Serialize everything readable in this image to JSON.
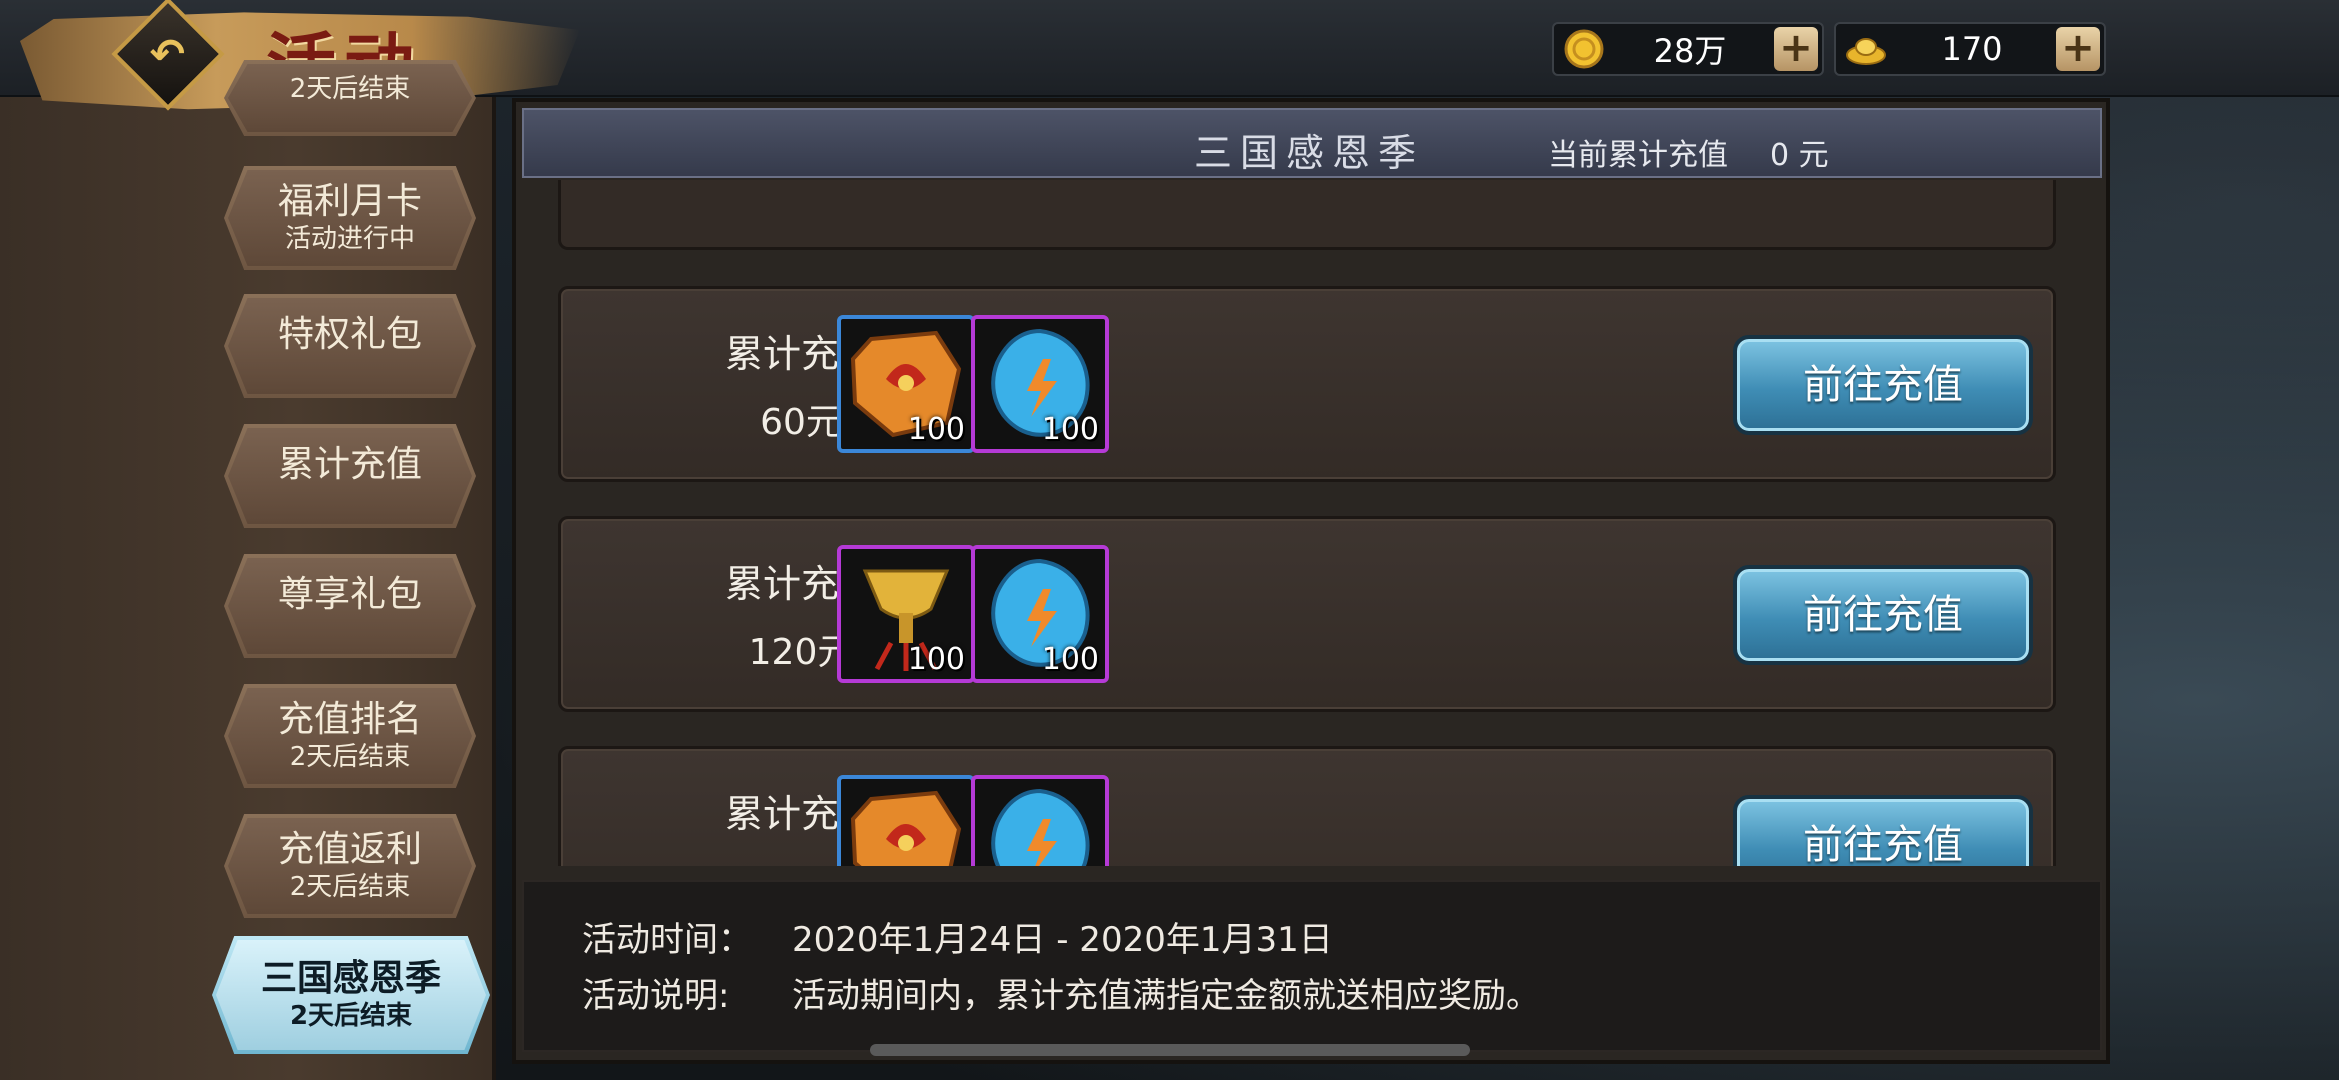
{
  "header": {
    "title": "活动",
    "back_icon": "back-arrow-icon",
    "currencies": [
      {
        "icon": "gold-coin-icon",
        "value": "28万"
      },
      {
        "icon": "gold-ingot-icon",
        "value": "170"
      }
    ]
  },
  "sidebar": {
    "partial_top": {
      "line2": "2天后结束"
    },
    "items": [
      {
        "line1": "福利月卡",
        "line2": "活动进行中"
      },
      {
        "line1": "特权礼包",
        "line2": ""
      },
      {
        "line1": "累计充值",
        "line2": ""
      },
      {
        "line1": "尊享礼包",
        "line2": ""
      },
      {
        "line1": "充值排名",
        "line2": "2天后结束"
      },
      {
        "line1": "充值返利",
        "line2": "2天后结束"
      },
      {
        "line1": "三国感恩季",
        "line2": "2天后结束"
      }
    ],
    "active_index": 6
  },
  "panel": {
    "title": "三国感恩季",
    "recharge_label": "当前累计充值",
    "recharge_value": "0 元",
    "rows": [
      {
        "label": "累计充值",
        "amount": "60元",
        "button": "前往充值",
        "items": [
          {
            "icon": "orange-rune-stone-icon",
            "qty": "100",
            "frame": "blue"
          },
          {
            "icon": "blue-crystal-icon",
            "qty": "100",
            "frame": "purple"
          }
        ]
      },
      {
        "label": "累计充值",
        "amount": "120元",
        "button": "前往充值",
        "items": [
          {
            "icon": "golden-goblet-icon",
            "qty": "100",
            "frame": "purple"
          },
          {
            "icon": "blue-crystal-icon",
            "qty": "100",
            "frame": "purple"
          }
        ]
      },
      {
        "label": "累计充值",
        "amount": "",
        "button": "前往充值",
        "items": [
          {
            "icon": "orange-rune-stone-icon",
            "qty": "",
            "frame": "blue"
          },
          {
            "icon": "blue-crystal-icon",
            "qty": "",
            "frame": "purple"
          }
        ]
      }
    ]
  },
  "info": {
    "time_label": "活动时间：",
    "time_value": "2020年1月24日 - 2020年1月31日",
    "desc_label": "活动说明:",
    "desc_value": "活动期间内，累计充值满指定金额就送相应奖励。"
  }
}
